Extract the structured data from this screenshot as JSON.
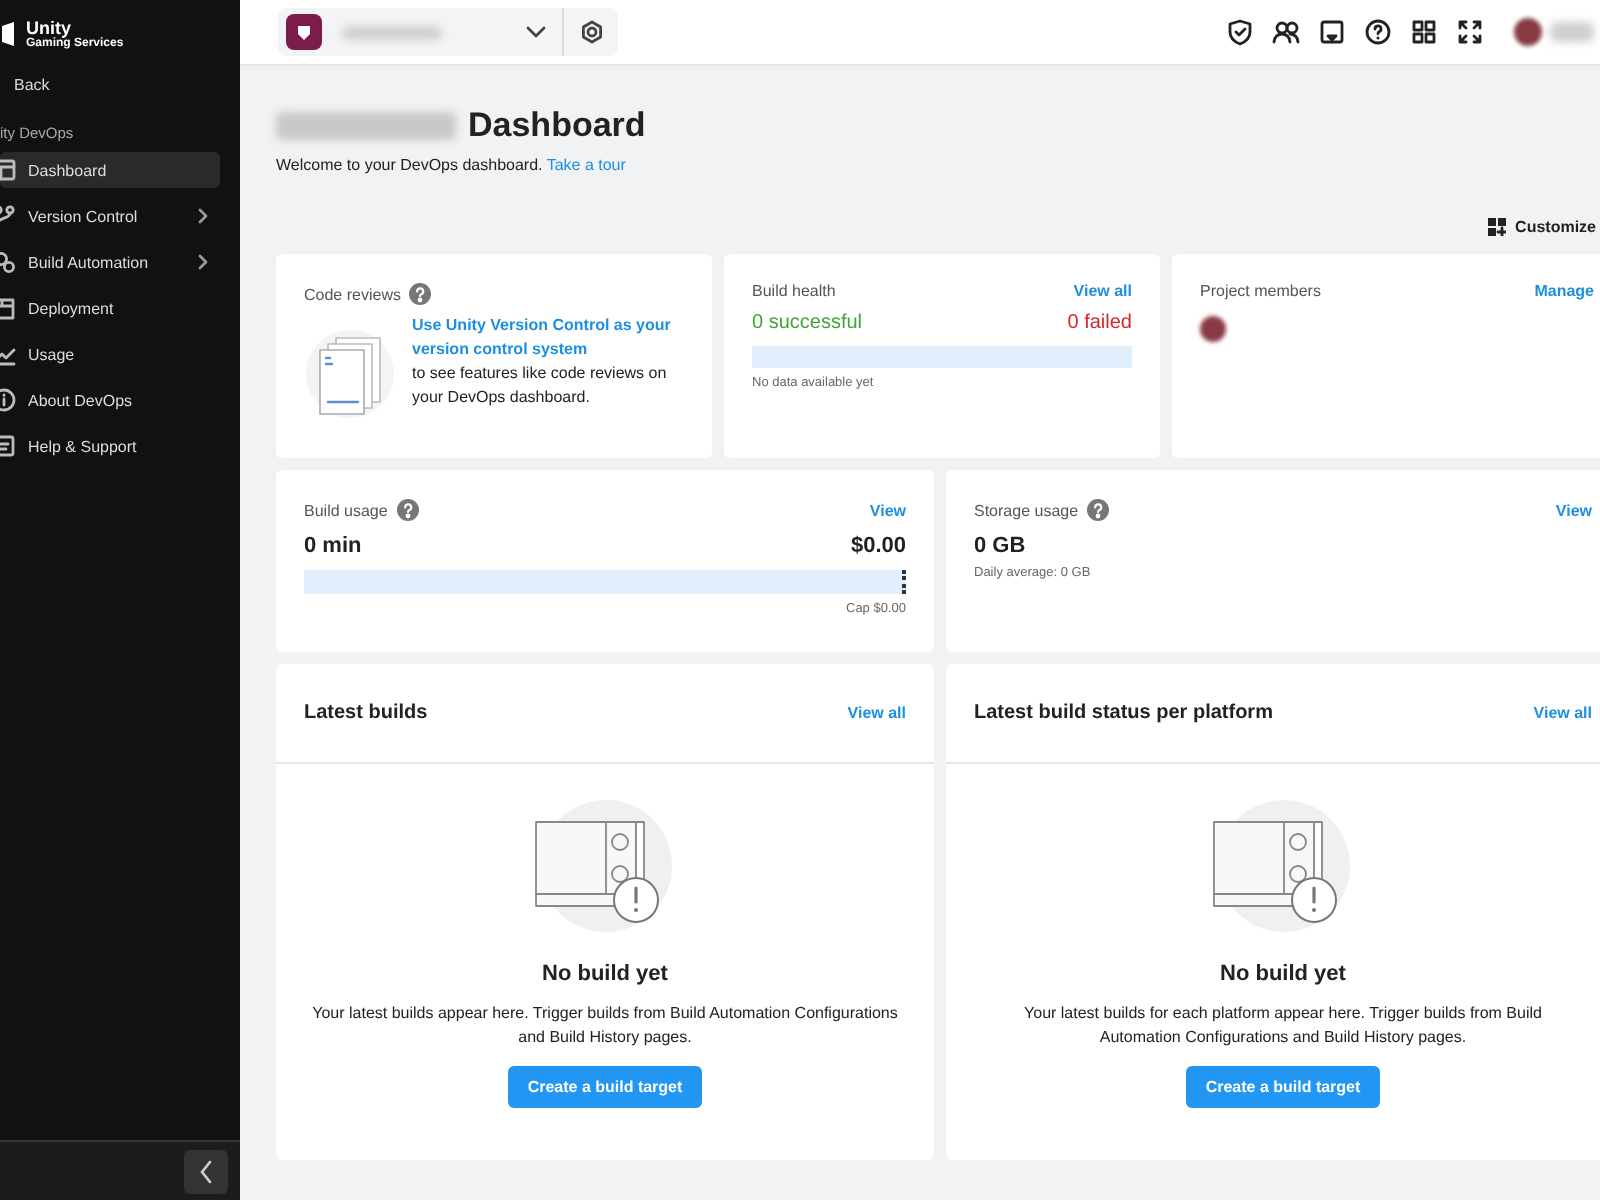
{
  "sidebar": {
    "brand": {
      "title": "Unity",
      "subtitle": "Gaming Services"
    },
    "back": "Back",
    "section": "ity DevOps",
    "items": [
      {
        "label": "Dashboard",
        "selected": true,
        "submenu": false
      },
      {
        "label": "Version Control",
        "selected": false,
        "submenu": true
      },
      {
        "label": "Build Automation",
        "selected": false,
        "submenu": true
      },
      {
        "label": "Deployment",
        "selected": false,
        "submenu": false
      },
      {
        "label": "Usage",
        "selected": false,
        "submenu": false
      },
      {
        "label": "About DevOps",
        "selected": false,
        "submenu": false
      },
      {
        "label": "Help & Support",
        "selected": false,
        "submenu": false
      }
    ]
  },
  "header": {
    "title": "Dashboard",
    "welcome": "Welcome to your DevOps dashboard.",
    "tour_link": "Take a tour",
    "customize": "Customize"
  },
  "code_reviews": {
    "title": "Code reviews",
    "link": "Use Unity Version Control as your version control system",
    "text": " to see features like code reviews on your DevOps dashboard."
  },
  "build_health": {
    "title": "Build health",
    "link": "View all",
    "successful": "0 successful",
    "failed": "0 failed",
    "note": "No data available yet"
  },
  "project_members": {
    "title": "Project members",
    "link": "Manage"
  },
  "build_usage": {
    "title": "Build usage",
    "link": "View",
    "minutes": "0 min",
    "cost": "$0.00",
    "cap": "Cap $0.00"
  },
  "storage_usage": {
    "title": "Storage usage",
    "link": "View",
    "amount": "0 GB",
    "daily": "Daily average: 0 GB"
  },
  "panels": [
    {
      "title": "Latest builds",
      "link": "View all",
      "empty_title": "No build yet",
      "empty_text": "Your latest builds appear here. Trigger builds from Build Automation Configurations and Build History pages.",
      "button": "Create a build target"
    },
    {
      "title": "Latest build status per platform",
      "link": "View all",
      "empty_title": "No build yet",
      "empty_text": "Your latest builds for each platform appear here. Trigger builds from Build Automation Configurations and Build History pages.",
      "button": "Create a build target"
    }
  ]
}
